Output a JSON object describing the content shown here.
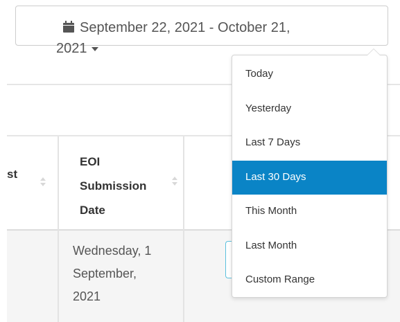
{
  "date_picker": {
    "range_line1": "September 22, 2021 - October 21,",
    "range_line2": "2021",
    "icon": "calendar-icon",
    "dropdown_icon": "caret-down-icon"
  },
  "ranges": [
    {
      "label": "Today",
      "active": false
    },
    {
      "label": "Yesterday",
      "active": false
    },
    {
      "label": "Last 7 Days",
      "active": false
    },
    {
      "label": "Last 30 Days",
      "active": true
    },
    {
      "label": "This Month",
      "active": false
    },
    {
      "label": "Last Month",
      "active": false
    },
    {
      "label": "Custom Range",
      "active": false
    }
  ],
  "table": {
    "headers": {
      "col1_partial": "st",
      "col2": [
        "EOI",
        "Submission",
        "Date"
      ]
    },
    "rows": [
      {
        "submission_date": [
          "Wednesday, 1",
          "September,",
          "2021"
        ]
      }
    ]
  },
  "colors": {
    "accent": "#0a84c6",
    "row_background": "#f5f5f5",
    "button_border": "#cccccc"
  }
}
